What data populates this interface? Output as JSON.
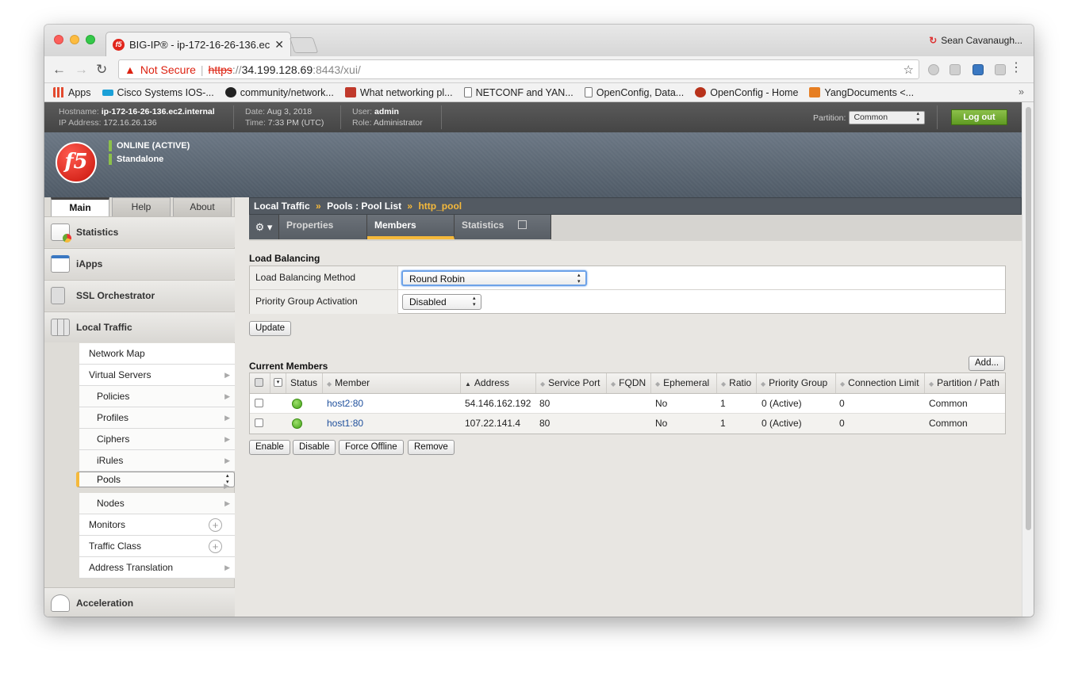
{
  "browser": {
    "tab_title": "BIG-IP® - ip-172-16-26-136.ec",
    "tab_close": "✕",
    "user": "Sean Cavanaugh...",
    "not_secure": "Not Secure",
    "url_proto": "https",
    "url_sep": "://",
    "url_host": "34.199.128.69",
    "url_path": ":8443/xui/",
    "bookmarks": [
      {
        "label": "Apps",
        "color": "#e34a2f"
      },
      {
        "label": "Cisco Systems IOS-...",
        "color": "#1ba0d7"
      },
      {
        "label": "community/network...",
        "color": "#222222"
      },
      {
        "label": "What networking pl...",
        "color": "#c0392b"
      },
      {
        "label": "NETCONF and YAN...",
        "color": "#ffffff"
      },
      {
        "label": "OpenConfig, Data...",
        "color": "#ffffff"
      },
      {
        "label": "OpenConfig - Home",
        "color": "#b8321b"
      },
      {
        "label": "YangDocuments <...",
        "color": "#e67e22"
      }
    ]
  },
  "infobar": {
    "hostname_label": "Hostname:",
    "hostname": "ip-172-16-26-136.ec2.internal",
    "ip_label": "IP Address:",
    "ip": "172.16.26.136",
    "date_label": "Date:",
    "date": "Aug 3, 2018",
    "time_label": "Time:",
    "time": "7:33 PM (UTC)",
    "user_label": "User:",
    "user": "admin",
    "role_label": "Role:",
    "role": "Administrator",
    "partition_label": "Partition:",
    "partition": "Common",
    "logout": "Log out"
  },
  "banner": {
    "logo": "f5",
    "status": "ONLINE (ACTIVE)",
    "mode": "Standalone"
  },
  "nav": {
    "tabs": [
      "Main",
      "Help",
      "About"
    ],
    "sections": [
      "Statistics",
      "iApps",
      "SSL Orchestrator",
      "Local Traffic",
      "Acceleration"
    ],
    "items": [
      "Network Map",
      "Virtual Servers",
      "Policies",
      "Profiles",
      "Ciphers",
      "iRules",
      "Pools",
      "Nodes",
      "Monitors",
      "Traffic Class",
      "Address Translation"
    ]
  },
  "breadcrumb": {
    "part1": "Local Traffic",
    "sep": "»",
    "part2": "Pools : Pool List",
    "current": "http_pool"
  },
  "tabs": {
    "gear": "⚙ ▾",
    "properties": "Properties",
    "members": "Members",
    "statistics": "Statistics"
  },
  "load_balancing": {
    "title": "Load Balancing",
    "method_label": "Load Balancing Method",
    "method_value": "Round Robin",
    "priority_label": "Priority Group Activation",
    "priority_value": "Disabled",
    "update": "Update"
  },
  "members": {
    "title": "Current Members",
    "add": "Add...",
    "columns": [
      "Status",
      "Member",
      "Address",
      "Service Port",
      "FQDN",
      "Ephemeral",
      "Ratio",
      "Priority Group",
      "Connection Limit",
      "Partition / Path"
    ],
    "rows": [
      {
        "member": "host2:80",
        "address": "54.146.162.192",
        "port": "80",
        "fqdn": "",
        "ephemeral": "No",
        "ratio": "1",
        "priority": "0  (Active)",
        "limit": "0",
        "partition": "Common"
      },
      {
        "member": "host1:80",
        "address": "107.22.141.4",
        "port": "80",
        "fqdn": "",
        "ephemeral": "No",
        "ratio": "1",
        "priority": "0  (Active)",
        "limit": "0",
        "partition": "Common"
      }
    ],
    "actions": [
      "Enable",
      "Disable",
      "Force Offline",
      "Remove"
    ]
  }
}
